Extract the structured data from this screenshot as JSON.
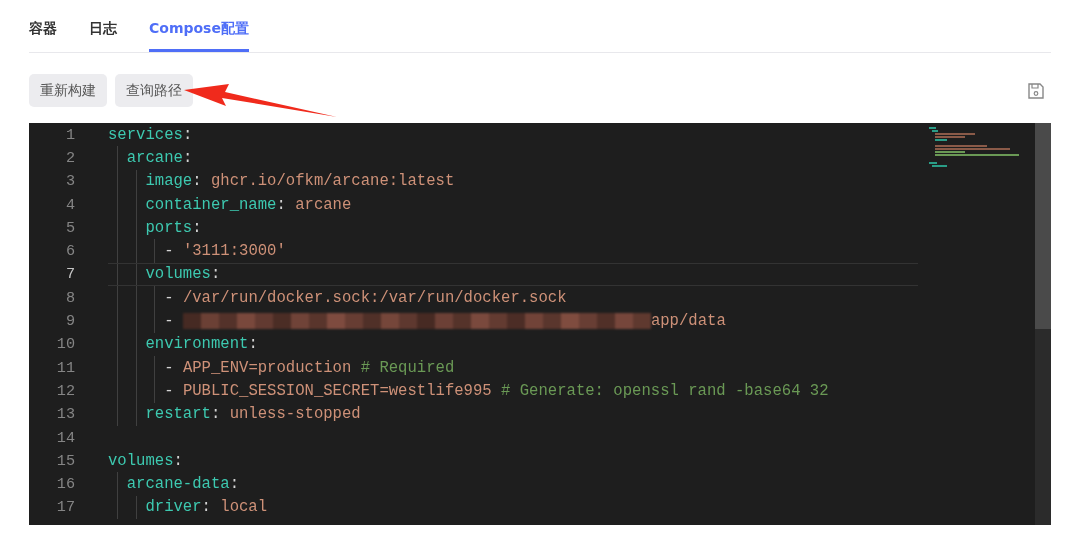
{
  "tabs": [
    {
      "label": "容器",
      "selected": false
    },
    {
      "label": "日志",
      "selected": false
    },
    {
      "label": "Compose配置",
      "selected": true
    }
  ],
  "toolbar": {
    "buttons": [
      "重新构建",
      "查询路径"
    ]
  },
  "editor": {
    "lines": [
      {
        "number": "1",
        "current": false,
        "tokens": [
          {
            "kind": "key",
            "text": "services"
          },
          {
            "kind": "punct",
            "text": ":"
          }
        ]
      },
      {
        "number": "2",
        "current": false,
        "tokens": [
          {
            "kind": "key",
            "text": "  arcane"
          },
          {
            "kind": "punct",
            "text": ":"
          }
        ]
      },
      {
        "number": "3",
        "current": false,
        "tokens": [
          {
            "kind": "key",
            "text": "    image"
          },
          {
            "kind": "punct",
            "text": ": "
          },
          {
            "kind": "string",
            "text": "ghcr.io/ofkm/arcane:latest"
          }
        ]
      },
      {
        "number": "4",
        "current": false,
        "tokens": [
          {
            "kind": "key",
            "text": "    container_name"
          },
          {
            "kind": "punct",
            "text": ": "
          },
          {
            "kind": "string",
            "text": "arcane"
          }
        ]
      },
      {
        "number": "5",
        "current": false,
        "tokens": [
          {
            "kind": "key",
            "text": "    ports"
          },
          {
            "kind": "punct",
            "text": ":"
          }
        ]
      },
      {
        "number": "6",
        "current": false,
        "tokens": [
          {
            "kind": "punct",
            "text": "      - "
          },
          {
            "kind": "string",
            "text": "'3111:3000'"
          }
        ]
      },
      {
        "number": "7",
        "current": true,
        "tokens": [
          {
            "kind": "key",
            "text": "    volumes"
          },
          {
            "kind": "punct",
            "text": ":"
          }
        ]
      },
      {
        "number": "8",
        "current": false,
        "tokens": [
          {
            "kind": "punct",
            "text": "      - "
          },
          {
            "kind": "string",
            "text": "/var/run/docker.sock:/var/run/docker.sock"
          }
        ]
      },
      {
        "number": "9",
        "current": false,
        "tokens": [
          {
            "kind": "punct",
            "text": "      - "
          },
          {
            "kind": "redacted"
          },
          {
            "kind": "string",
            "text": "app/data"
          }
        ]
      },
      {
        "number": "10",
        "current": false,
        "tokens": [
          {
            "kind": "key",
            "text": "    environment"
          },
          {
            "kind": "punct",
            "text": ":"
          }
        ]
      },
      {
        "number": "11",
        "current": false,
        "tokens": [
          {
            "kind": "punct",
            "text": "      - "
          },
          {
            "kind": "string",
            "text": "APP_ENV=production"
          },
          {
            "kind": "comment",
            "text": " # Required"
          }
        ]
      },
      {
        "number": "12",
        "current": false,
        "tokens": [
          {
            "kind": "punct",
            "text": "      - "
          },
          {
            "kind": "string",
            "text": "PUBLIC_SESSION_SECRET=westlife995"
          },
          {
            "kind": "comment",
            "text": " # Generate: openssl rand -base64 32"
          }
        ]
      },
      {
        "number": "13",
        "current": false,
        "tokens": [
          {
            "kind": "key",
            "text": "    restart"
          },
          {
            "kind": "punct",
            "text": ": "
          },
          {
            "kind": "string",
            "text": "unless-stopped"
          }
        ]
      },
      {
        "number": "14",
        "current": false
      },
      {
        "number": "15",
        "current": false,
        "tokens": [
          {
            "kind": "key",
            "text": "volumes"
          },
          {
            "kind": "punct",
            "text": ":"
          }
        ]
      },
      {
        "number": "16",
        "current": false,
        "tokens": [
          {
            "kind": "key",
            "text": "  arcane-data"
          },
          {
            "kind": "punct",
            "text": ":"
          }
        ]
      },
      {
        "number": "17",
        "current": false,
        "tokens": [
          {
            "kind": "key",
            "text": "    driver"
          },
          {
            "kind": "punct",
            "text": ": "
          },
          {
            "kind": "string",
            "text": "local"
          }
        ]
      }
    ]
  }
}
